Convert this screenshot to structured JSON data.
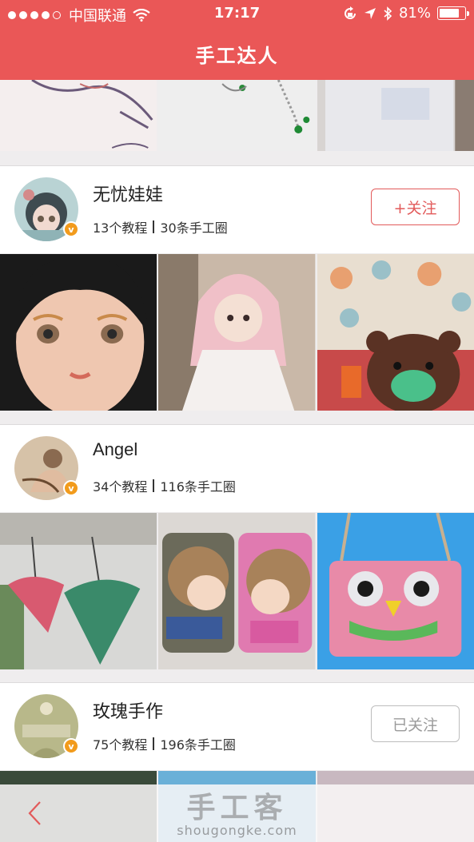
{
  "status_bar": {
    "carrier": "中国联通",
    "time": "17:17",
    "battery": "81%",
    "battery_level": 0.81,
    "icons": [
      "signal-dots",
      "wifi-icon",
      "orientation-lock-icon",
      "location-icon",
      "bluetooth-icon",
      "battery-icon"
    ]
  },
  "nav": {
    "title": "手工达人"
  },
  "colors": {
    "brand": "#ea5757",
    "follow": "#e25a5a",
    "followed": "#9a9a9a",
    "badge": "#f29b1c"
  },
  "users": [
    {
      "name": "无忧娃娃",
      "tutorials": "13个教程",
      "circles": "30条手工圈",
      "follow_label": "+关注",
      "followed": false,
      "verified_badge": "v"
    },
    {
      "name": "Angel",
      "tutorials": "34个教程",
      "circles": "116条手工圈",
      "verified_badge": "v"
    },
    {
      "name": "玫瑰手作",
      "tutorials": "75个教程",
      "circles": "196条手工圈",
      "follow_label": "已关注",
      "followed": true,
      "verified_badge": "v"
    }
  ],
  "footer": {
    "watermark_title": "手工客",
    "watermark_url": "shougongke.com",
    "back_icon": "chevron-left-icon"
  }
}
